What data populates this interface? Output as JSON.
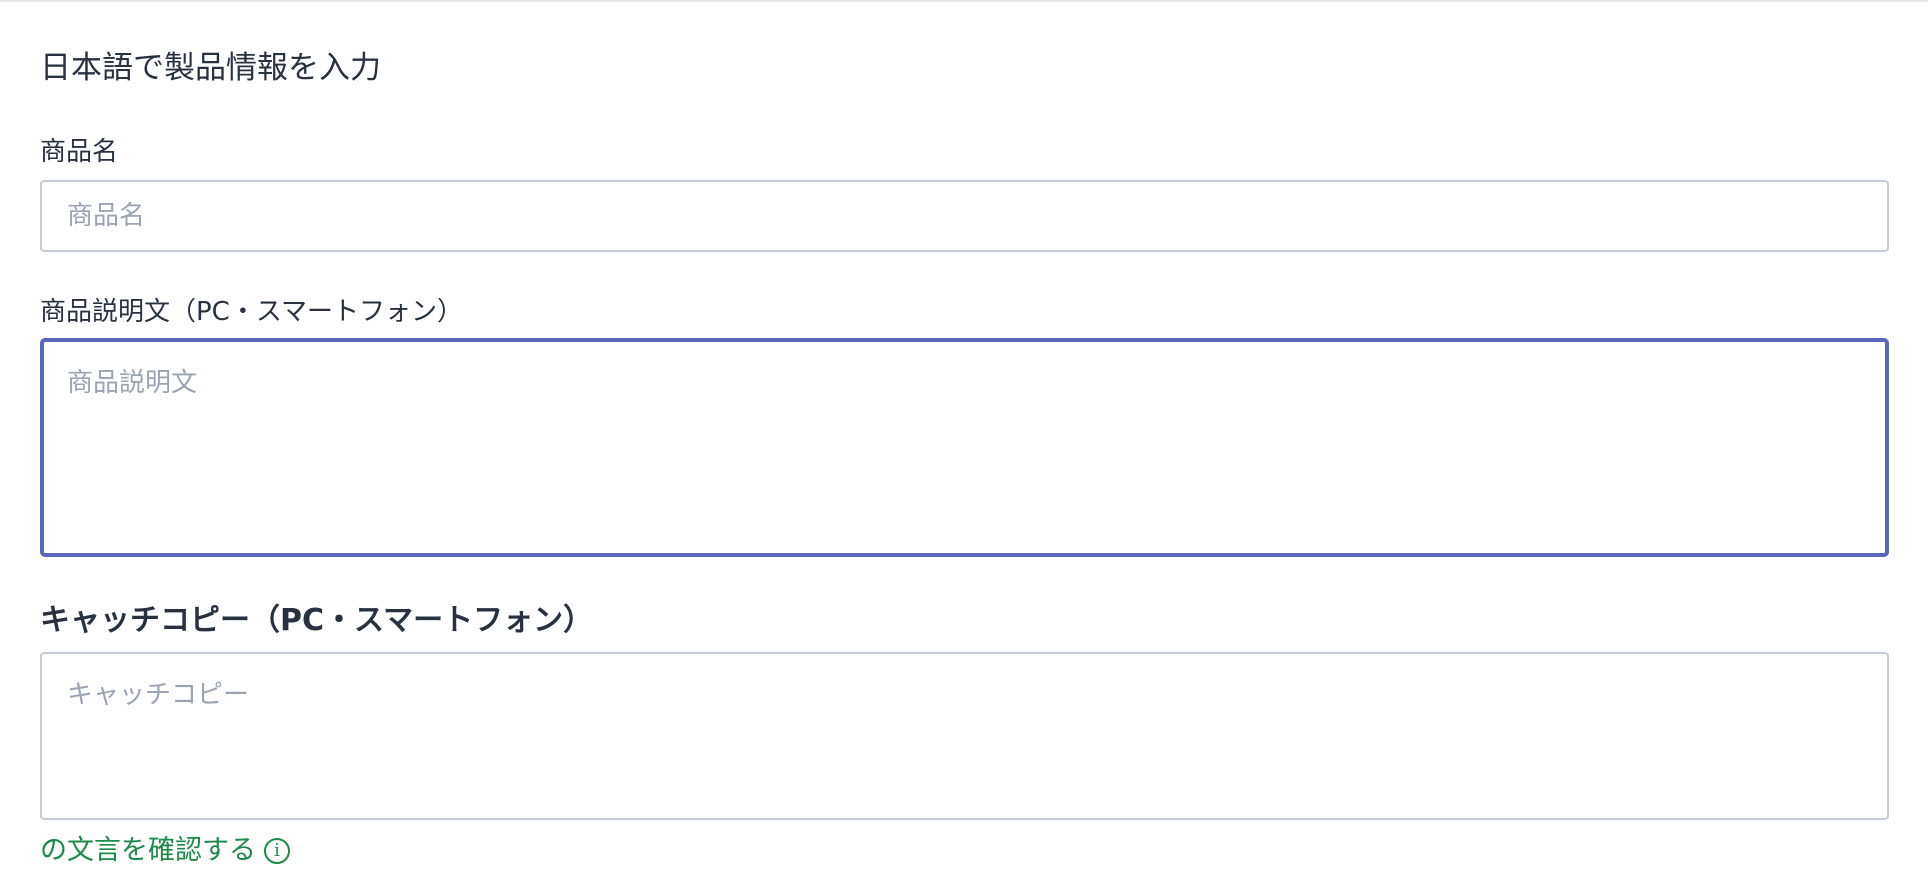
{
  "form": {
    "title": "日本語で製品情報を入力",
    "product_name": {
      "label": "商品名",
      "placeholder": "商品名",
      "value": ""
    },
    "description": {
      "label": "商品説明文（PC・スマートフォン）",
      "placeholder": "商品説明文",
      "value": ""
    },
    "catch_copy": {
      "label": "キャッチコピー（PC・スマートフォン）",
      "placeholder": "キャッチコピー",
      "value": ""
    },
    "check_link": {
      "label": "の文言を確認する",
      "icon": "info-icon"
    }
  },
  "colors": {
    "focus_border": "#5a67ba",
    "input_border": "#c5ccd6",
    "placeholder": "#9aa4b2",
    "link_green": "#1e8a4a"
  }
}
